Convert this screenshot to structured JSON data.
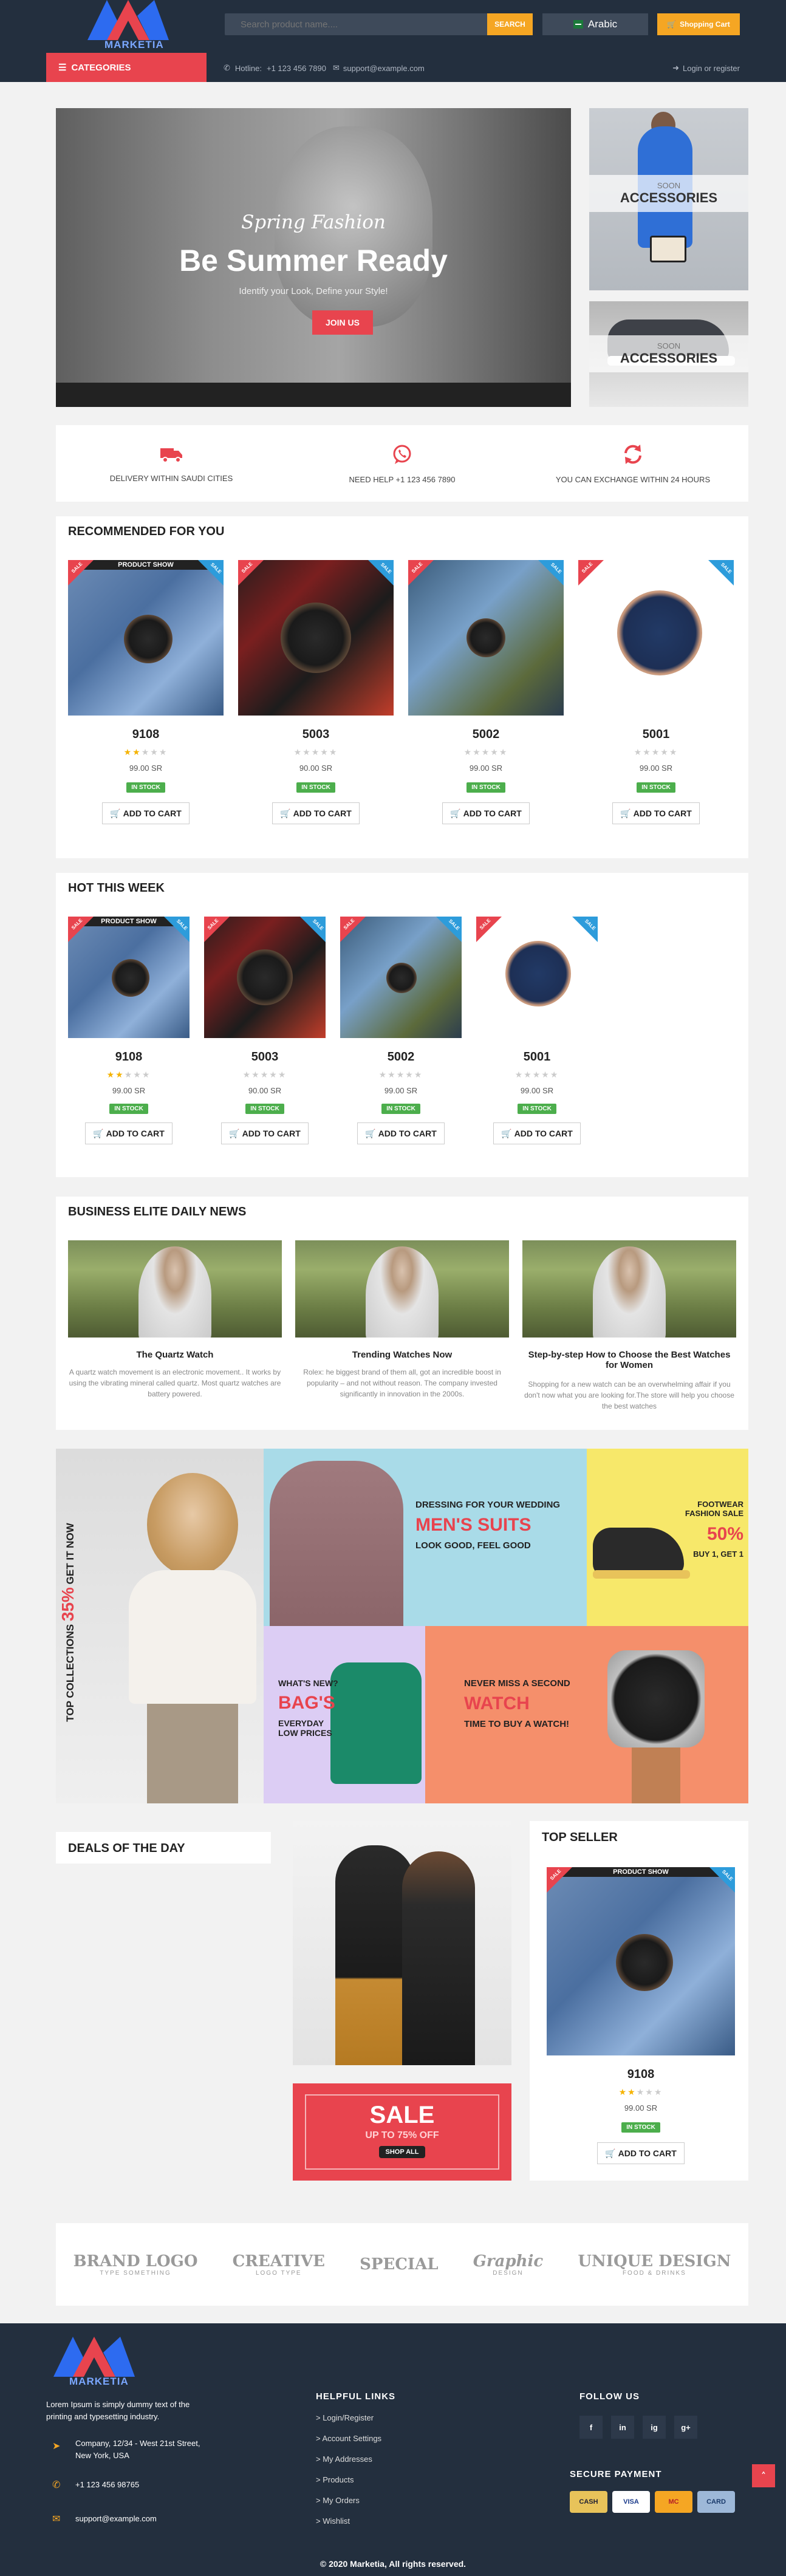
{
  "header": {
    "logo_text": "MARKETIA",
    "search_placeholder": "Search product name....",
    "search_button": "SEARCH",
    "language": "Arabic",
    "cart_button": "Shopping Cart",
    "categories_label": "CATEGORIES",
    "hotline_label": "Hotline:",
    "hotline_number": "+1 123 456 7890",
    "email": "support@example.com",
    "login": "Login or register"
  },
  "hero": {
    "script": "Spring Fashion",
    "title": "Be Summer Ready",
    "subtitle": "Identify your Look, Define your Style!",
    "button": "JOIN US"
  },
  "side_banners": [
    {
      "soon": "SOON",
      "label": "ACCESSORIES"
    },
    {
      "soon": "SOON",
      "label": "ACCESSORIES"
    }
  ],
  "features": [
    {
      "icon": "truck-icon",
      "label": "DELIVERY WITHIN SAUDI CITIES"
    },
    {
      "icon": "whatsapp-icon",
      "label": "NEED HELP +1 123 456 7890"
    },
    {
      "icon": "exchange-icon",
      "label": "YOU CAN EXCHANGE WITHIN 24 HOURS"
    }
  ],
  "recommended": {
    "title": "RECOMMENDED FOR YOU",
    "products": [
      {
        "name": "9108",
        "price": "99.00 SR",
        "stock": "IN STOCK",
        "cart": "ADD TO CART",
        "rating": 2,
        "ribbon": "PRODUCT SHOW",
        "corner": "SALE"
      },
      {
        "name": "5003",
        "price": "90.00 SR",
        "stock": "IN STOCK",
        "cart": "ADD TO CART",
        "rating": 0,
        "ribbon": "",
        "corner": "SALE"
      },
      {
        "name": "5002",
        "price": "99.00 SR",
        "stock": "IN STOCK",
        "cart": "ADD TO CART",
        "rating": 0,
        "ribbon": "",
        "corner": "SALE"
      },
      {
        "name": "5001",
        "price": "99.00 SR",
        "stock": "IN STOCK",
        "cart": "ADD TO CART",
        "rating": 0,
        "ribbon": "",
        "corner": "SALE"
      }
    ]
  },
  "hot": {
    "title": "HOT THIS WEEK",
    "products": [
      {
        "name": "9108",
        "price": "99.00 SR",
        "stock": "IN STOCK",
        "cart": "ADD TO CART",
        "rating": 2,
        "ribbon": "PRODUCT SHOW",
        "corner": "SALE"
      },
      {
        "name": "5003",
        "price": "90.00 SR",
        "stock": "IN STOCK",
        "cart": "ADD TO CART",
        "rating": 0,
        "ribbon": "",
        "corner": "SALE"
      },
      {
        "name": "5002",
        "price": "99.00 SR",
        "stock": "IN STOCK",
        "cart": "ADD TO CART",
        "rating": 0,
        "ribbon": "",
        "corner": "SALE"
      },
      {
        "name": "5001",
        "price": "99.00 SR",
        "stock": "IN STOCK",
        "cart": "ADD TO CART",
        "rating": 0,
        "ribbon": "",
        "corner": "SALE"
      }
    ]
  },
  "news": {
    "title": "BUSINESS ELITE DAILY NEWS",
    "items": [
      {
        "title": "The Quartz Watch",
        "text": "A quartz watch movement is an electronic movement.. It works by using the vibrating mineral called quartz. Most quartz watches are battery powered."
      },
      {
        "title": "Trending Watches Now",
        "text": "Rolex: he biggest brand of them all, got an incredible boost in popularity – and not without reason. The company invested significantly in innovation in the 2000s."
      },
      {
        "title": "Step-by-step How to Choose the Best Watches for Women",
        "text": "Shopping for a new watch can be an overwhelming affair if you don't now what you are looking for.The store will help you choose the best watches"
      }
    ]
  },
  "promo": {
    "vertical_a": "TOP COLLECTIONS",
    "vertical_b": "35%",
    "vertical_c": "GET IT NOW",
    "suits_small": "DRESSING FOR YOUR WEDDING",
    "suits_big": "MEN'S SUITS",
    "suits_sub": "LOOK GOOD, FEEL GOOD",
    "foot_small": "FOOTWEAR FASHION SALE",
    "foot_big": "50%",
    "foot_sub": "BUY 1, GET 1",
    "bag_small": "WHAT'S NEW?",
    "bag_big": "BAG'S",
    "bag_sub": "EVERYDAY LOW PRICES",
    "watch_small": "NEVER MISS A SECOND",
    "watch_big": "WATCH",
    "watch_sub": "TIME TO BUY A WATCH!"
  },
  "deals": {
    "title": "DEALS OF THE DAY",
    "sale_big": "SALE",
    "sale_sub": "UP TO 75% OFF",
    "sale_btn": "SHOP ALL"
  },
  "top_seller": {
    "title": "TOP SELLER",
    "product": {
      "name": "9108",
      "price": "99.00 SR",
      "stock": "IN STOCK",
      "cart": "ADD TO CART",
      "rating": 2,
      "ribbon": "PRODUCT SHOW",
      "corner": "SALE"
    }
  },
  "brands": [
    {
      "name": "BRAND LOGO",
      "tag": "TYPE SOMETHING"
    },
    {
      "name": "CREATIVE",
      "tag": "LOGO TYPE"
    },
    {
      "name": "SPECIAL",
      "tag": ""
    },
    {
      "name": "Graphic",
      "tag": "DESIGN"
    },
    {
      "name": "UNIQUE DESIGN",
      "tag": "FOOD & DRINKS"
    }
  ],
  "footer": {
    "about": "Lorem Ipsum is simply dummy text of the printing and typesetting industry.",
    "address": "Company, 12/34 - West 21st Street, New York, USA",
    "phone": "+1 123 456 98765",
    "email": "support@example.com",
    "links_title": "HELPFUL LINKS",
    "links": [
      "> Login/Register",
      "> Account Settings",
      "> My Addresses",
      "> Products",
      "> My Orders",
      "> Wishlist"
    ],
    "follow_title": "FOLLOW US",
    "social": [
      "f",
      "in",
      "ig",
      "g+"
    ],
    "secure_title": "SECURE PAYMENT",
    "cards": [
      "CASH",
      "VISA",
      "MC",
      "CARD"
    ],
    "copyright": "© 2020 Marketia, All rights reserved."
  },
  "colors": {
    "accent": "#e8444e",
    "navy": "#232f3e",
    "orange": "#f5a623",
    "green": "#4cae4c"
  }
}
